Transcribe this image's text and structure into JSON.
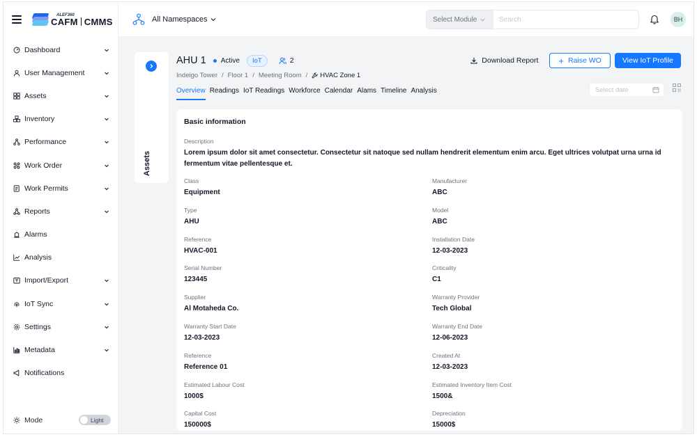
{
  "brand": {
    "top": "ALEF360",
    "left": "CAFM",
    "right": "CMMS"
  },
  "sidebar": {
    "items": [
      {
        "label": "Dashboard",
        "icon": "dashboard-icon",
        "chevron": true
      },
      {
        "label": "User Management",
        "icon": "user-icon",
        "chevron": true
      },
      {
        "label": "Assets",
        "icon": "assets-icon",
        "chevron": true
      },
      {
        "label": "Inventory",
        "icon": "inventory-icon",
        "chevron": true
      },
      {
        "label": "Performance",
        "icon": "performance-icon",
        "chevron": true
      },
      {
        "label": "Work Order",
        "icon": "work-order-icon",
        "chevron": true
      },
      {
        "label": "Work Permits",
        "icon": "work-permits-icon",
        "chevron": true
      },
      {
        "label": "Reports",
        "icon": "reports-icon",
        "chevron": true
      },
      {
        "label": "Alarms",
        "icon": "alarm-icon",
        "chevron": false
      },
      {
        "label": "Analysis",
        "icon": "analysis-icon",
        "chevron": false
      },
      {
        "label": "Import/Export",
        "icon": "import-export-icon",
        "chevron": true
      },
      {
        "label": "IoT Sync",
        "icon": "iot-sync-icon",
        "chevron": true
      },
      {
        "label": "Settings",
        "icon": "settings-icon",
        "chevron": true
      },
      {
        "label": "Metadata",
        "icon": "metadata-icon",
        "chevron": true
      },
      {
        "label": "Notifications",
        "icon": "notifications-icon",
        "chevron": false
      }
    ],
    "mode_label": "Mode",
    "mode_value": "Light"
  },
  "topbar": {
    "namespace": "All Namespaces",
    "module_select": "Select Module",
    "search_placeholder": "Search",
    "avatar": "BH"
  },
  "collapsed_panel": {
    "label": "Assets"
  },
  "asset": {
    "title": "AHU 1",
    "status": "Active",
    "iot_badge": "IoT",
    "user_count": "2",
    "breadcrumb": [
      "Indeigo Tower",
      "Floor 1",
      "Meeting Room"
    ],
    "breadcrumb_current": "HVAC Zone 1"
  },
  "actions": {
    "download": "Download Report",
    "raise": "Raise WO",
    "view_iot": "View IoT Profile"
  },
  "tabs": [
    "Overview",
    "Readings",
    "IoT Readings",
    "Workforce",
    "Calendar",
    "Alams",
    "Timeline",
    "Analysis"
  ],
  "date_placeholder": "Select date",
  "card": {
    "title": "Basic information",
    "description_label": "Description",
    "description": "Lorem ipsum dolor sit amet consectetur. Consectetur sit natoque sed nullam hendrerit elementum enim arcu. Eget ultrices volutpat urna urna id fermentum vitae pellentesque et.",
    "fields": [
      {
        "label": "Class",
        "value": "Equipment"
      },
      {
        "label": "Manufacturer",
        "value": "ABC"
      },
      {
        "label": "Type",
        "value": "AHU"
      },
      {
        "label": "Model",
        "value": "ABC"
      },
      {
        "label": "Reference",
        "value": "HVAC-001"
      },
      {
        "label": "Installation Date",
        "value": "12-03-2023"
      },
      {
        "label": "Serial Number",
        "value": "123445"
      },
      {
        "label": "Criticality",
        "value": "C1"
      },
      {
        "label": "Supplier",
        "value": "Al Motaheda Co."
      },
      {
        "label": "Warranty Provider",
        "value": "Tech Global"
      },
      {
        "label": "Warranty Start Date",
        "value": "12-03-2023"
      },
      {
        "label": "Warranty End Date",
        "value": "12-06-2023"
      },
      {
        "label": "Reference",
        "value": "Reference 01"
      },
      {
        "label": "Created At",
        "value": "12-03-2023"
      },
      {
        "label": "Estimated Labour Cost",
        "value": "1000$"
      },
      {
        "label": "Estimated Inventory Item Cost",
        "value": "1500&"
      },
      {
        "label": "Capital Cost",
        "value": "150000$"
      },
      {
        "label": "Depreciation",
        "value": "15000$"
      }
    ]
  },
  "colors": {
    "accent": "#1677ff",
    "avatar_bg": "#d7efe9"
  }
}
